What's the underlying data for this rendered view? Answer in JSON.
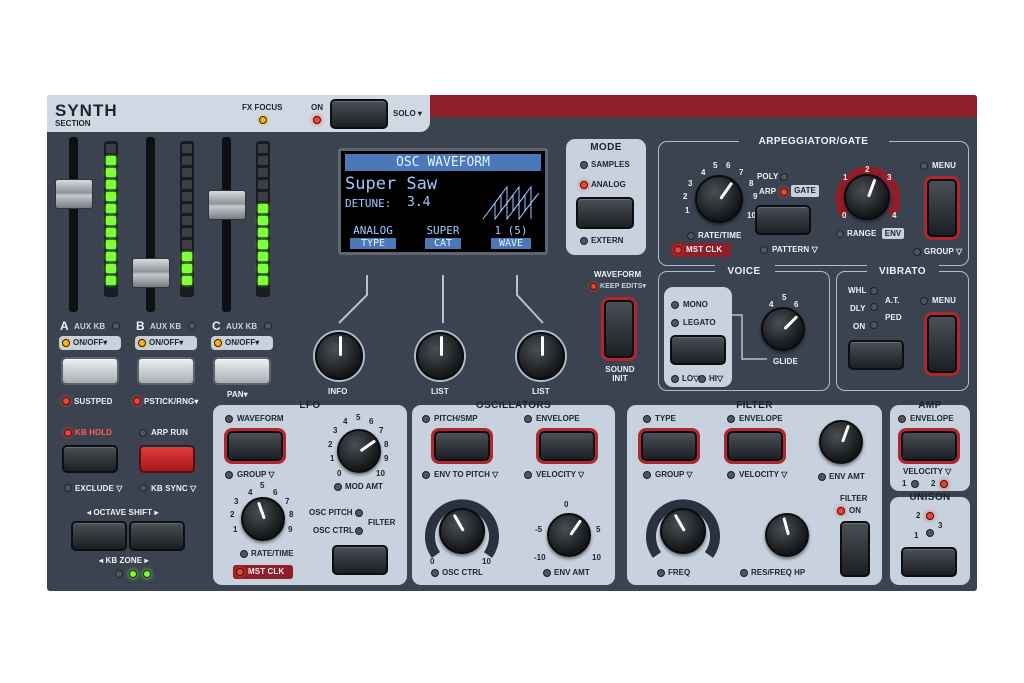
{
  "header": {
    "title": "SYNTH",
    "subtitle": "SECTION",
    "fx_focus": "FX FOCUS",
    "on": "ON",
    "solo": "SOLO ▾"
  },
  "layers": [
    {
      "letter": "A",
      "aux": "AUX KB",
      "onoff": "ON/OFF▾",
      "under": "SUSTPED"
    },
    {
      "letter": "B",
      "aux": "AUX KB",
      "onoff": "ON/OFF▾",
      "under": "PSTICK/RNG▾"
    },
    {
      "letter": "C",
      "aux": "AUX KB",
      "onoff": "ON/OFF▾",
      "under": "PAN▾"
    }
  ],
  "meters": {
    "a_level": 0.75,
    "b_level": 0.25,
    "c_level": 0.55
  },
  "keyboard": {
    "kb_hold": "KB HOLD",
    "arp_run": "ARP RUN",
    "exclude": "EXCLUDE ▽",
    "kb_sync": "KB SYNC ▽",
    "octave_shift": "◂ OCTAVE SHIFT ▸",
    "kb_zone": "◂ KB ZONE ▸"
  },
  "display": {
    "header": "OSC WAVEFORM",
    "name": "Super Saw",
    "param": "DETUNE:",
    "value": "3.4",
    "softkeys": [
      {
        "top": "ANALOG",
        "bottom": "TYPE"
      },
      {
        "top": "SUPER",
        "bottom": "CAT"
      },
      {
        "top": "1 (5)",
        "bottom": "WAVE"
      }
    ]
  },
  "display_knobs": [
    "INFO",
    "LIST",
    "LIST"
  ],
  "mode": {
    "title": "MODE",
    "samples": "SAMPLES",
    "analog": "ANALOG",
    "extern": "EXTERN"
  },
  "waveform": {
    "title": "WAVEFORM",
    "keep": "KEEP EDITS▾",
    "sound_init": "SOUND INIT"
  },
  "arp": {
    "title": "ARPEGGIATOR/GATE",
    "rate": "RATE/TIME",
    "mst": "MST CLK",
    "poly": "POLY",
    "arp": "ARP",
    "gate": "GATE",
    "pattern": "PATTERN ▽",
    "range": "RANGE",
    "env": "ENV",
    "menu": "MENU",
    "group": "GROUP ▽",
    "ticks": [
      "1",
      "2",
      "3",
      "4",
      "5",
      "6",
      "7",
      "8",
      "9",
      "10",
      "0"
    ],
    "range_ticks": [
      "0",
      "1",
      "2",
      "3",
      "4"
    ]
  },
  "voice": {
    "title": "VOICE",
    "mono": "MONO",
    "legato": "LEGATO",
    "glide": "GLIDE",
    "lo": "LO▽",
    "hi": "HI▽"
  },
  "vibrato": {
    "title": "VIBRATO",
    "whl": "WHL",
    "at": "A.T.",
    "dly": "DLY",
    "ped": "PED",
    "on": "ON",
    "menu": "MENU"
  },
  "lfo": {
    "title": "LFO",
    "waveform": "WAVEFORM",
    "group": "GROUP ▽",
    "rate": "RATE/TIME",
    "mst": "MST CLK",
    "mod_amt": "MOD AMT",
    "osc_pitch": "OSC PITCH",
    "osc_ctrl": "OSC CTRL",
    "filter": "FILTER"
  },
  "osc": {
    "title": "OSCILLATORS",
    "pitch_smp": "PITCH/SMP",
    "envelope": "ENVELOPE",
    "env_to_pitch": "ENV TO PITCH ▽",
    "velocity": "VELOCITY ▽",
    "osc_ctrl": "OSC CTRL",
    "env_amt": "ENV AMT",
    "neg": "-5",
    "neg2": "-10",
    "zero": "0",
    "five": "5",
    "ten": "10"
  },
  "filter": {
    "title": "FILTER",
    "type": "TYPE",
    "envelope": "ENVELOPE",
    "group": "GROUP ▽",
    "velocity": "VELOCITY ▽",
    "env_amt": "ENV AMT",
    "freq": "FREQ",
    "res": "RES/FREQ HP",
    "filter_on": "FILTER",
    "on": "ON"
  },
  "amp": {
    "title": "AMP",
    "envelope": "ENVELOPE",
    "velocity": "VELOCITY ▽",
    "v1": "1",
    "v2": "2"
  },
  "unison": {
    "title": "UNISON",
    "u1": "1",
    "u2": "2",
    "u3": "3"
  }
}
